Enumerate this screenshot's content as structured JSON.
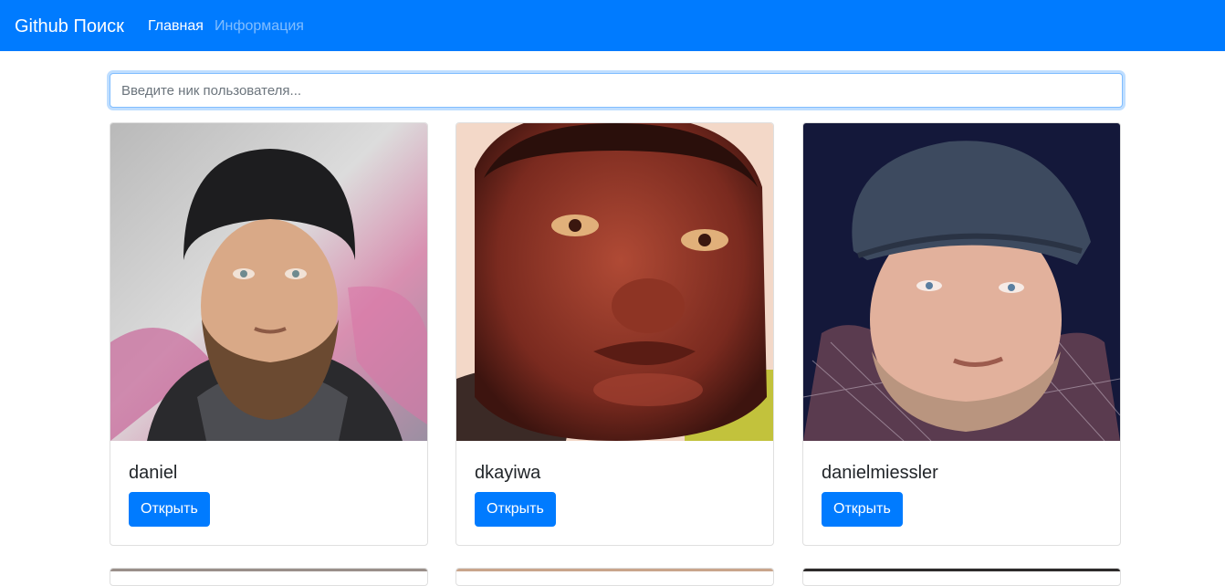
{
  "navbar": {
    "brand": "Github Поиск",
    "links": [
      {
        "label": "Главная",
        "active": true
      },
      {
        "label": "Информация",
        "active": false
      }
    ],
    "color": "#007bff"
  },
  "search": {
    "placeholder": "Введите ник пользователя...",
    "value": ""
  },
  "users": [
    {
      "login": "daniel",
      "button_label": "Открыть"
    },
    {
      "login": "dkayiwa",
      "button_label": "Открыть"
    },
    {
      "login": "danielmiessler",
      "button_label": "Открыть"
    }
  ],
  "colors": {
    "primary": "#007bff"
  }
}
